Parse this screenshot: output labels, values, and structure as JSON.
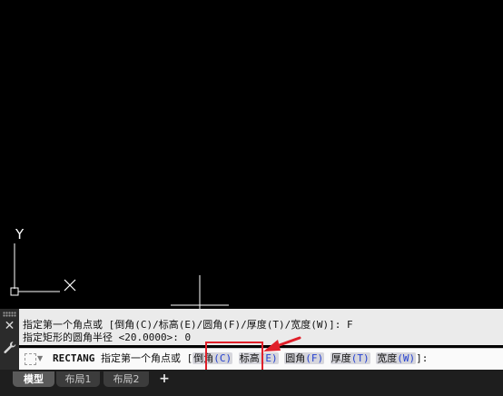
{
  "ucs": {
    "y_label": "Y"
  },
  "command_history": [
    "指定第一个角点或 [倒角(C)/标高(E)/圆角(F)/厚度(T)/宽度(W)]: F",
    "指定矩形的圆角半径 <20.0000>: 0"
  ],
  "command_line": {
    "command": "RECTANG",
    "prompt": "指定第一个角点或",
    "open_bracket": "[",
    "close_bracket": "]:",
    "options": [
      {
        "label": "倒角",
        "key": "(C)"
      },
      {
        "label": "标高",
        "key": "(E)"
      },
      {
        "label": "圆角",
        "key": "(F)"
      },
      {
        "label": "厚度",
        "key": "(T)"
      },
      {
        "label": "宽度",
        "key": "(W)"
      }
    ]
  },
  "tabs": [
    {
      "label": "模型",
      "active": true
    },
    {
      "label": "布局1",
      "active": false
    },
    {
      "label": "布局2",
      "active": false
    }
  ],
  "tab_add_label": "+",
  "colors": {
    "highlight": "#e0202a",
    "option_key": "#2440d0"
  }
}
